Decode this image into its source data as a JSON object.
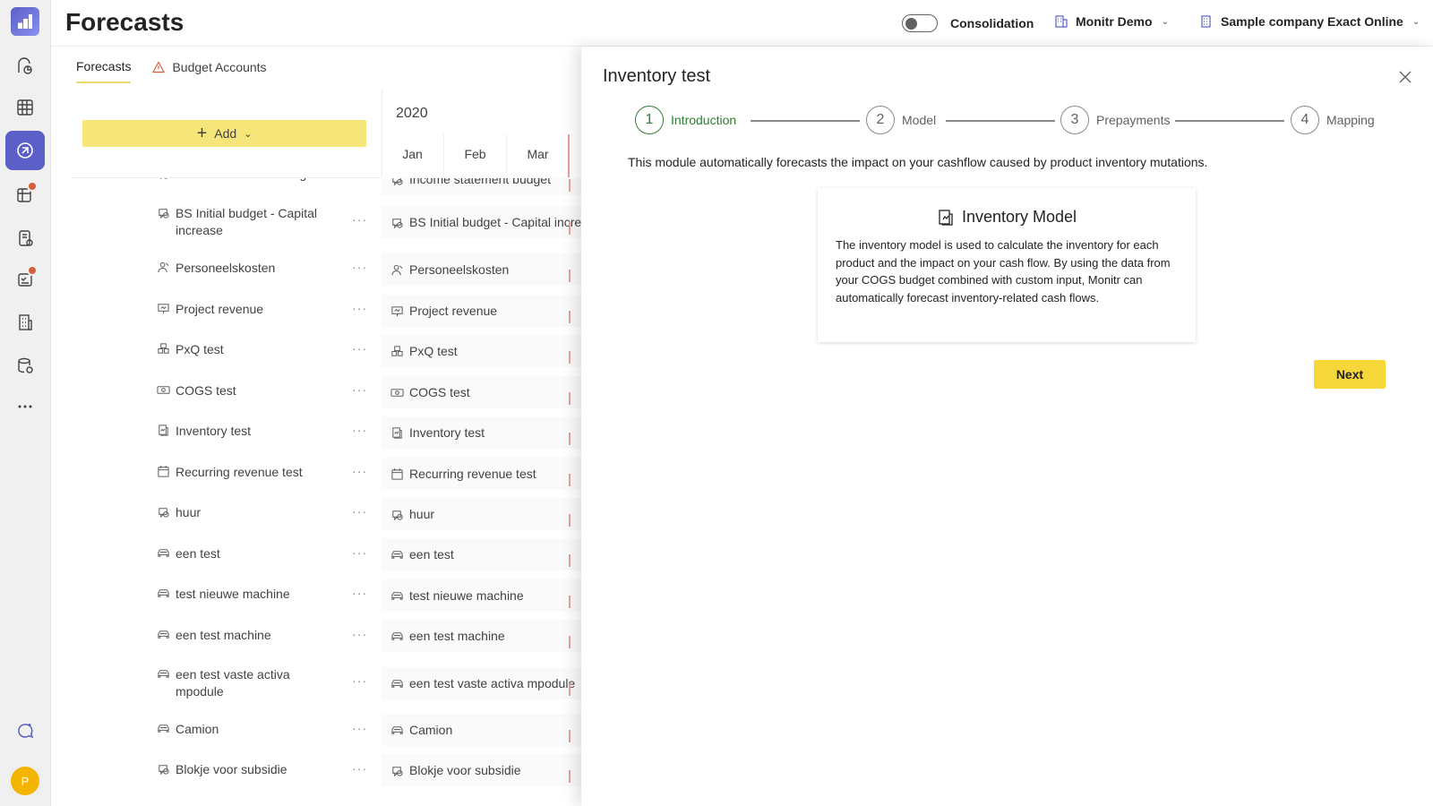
{
  "header": {
    "title": "Forecasts",
    "consolidation_label": "Consolidation",
    "environment": "Monitr Demo",
    "company": "Sample company Exact Online"
  },
  "tabs": [
    {
      "label": "Forecasts",
      "active": true
    },
    {
      "label": "Budget Accounts",
      "icon": "warning-icon"
    }
  ],
  "toolbar": {
    "add_label": "Add"
  },
  "timeline": {
    "year": "2020",
    "months": [
      "Jan",
      "Feb",
      "Mar"
    ]
  },
  "forecasts": [
    {
      "name": "Income statement budget",
      "cell": "Income statement budget",
      "icon": "budget-icon"
    },
    {
      "name": "BS Initial budget - Capital increase",
      "cell": "BS Initial budget - Capital increase",
      "icon": "budget-icon"
    },
    {
      "name": "Personeelskosten",
      "cell": "Personeelskosten",
      "icon": "person-icon"
    },
    {
      "name": "Project revenue",
      "cell": "Project revenue",
      "icon": "presentation-icon"
    },
    {
      "name": "PxQ test",
      "cell": "PxQ test",
      "icon": "boxes-icon"
    },
    {
      "name": "COGS test",
      "cell": "COGS test",
      "icon": "money-icon"
    },
    {
      "name": "Inventory test",
      "cell": "Inventory test",
      "icon": "inventory-icon"
    },
    {
      "name": "Recurring revenue test",
      "cell": "Recurring revenue test",
      "icon": "calendar-icon"
    },
    {
      "name": "huur",
      "cell": "huur",
      "icon": "budget-icon"
    },
    {
      "name": "een test",
      "cell": "een test",
      "icon": "vehicle-icon"
    },
    {
      "name": "test nieuwe machine",
      "cell": "test nieuwe machine",
      "icon": "vehicle-icon"
    },
    {
      "name": "een test machine",
      "cell": "een test machine",
      "icon": "vehicle-icon"
    },
    {
      "name": "een test vaste activa mpodule",
      "cell": "een test vaste activa mpodule",
      "icon": "vehicle-icon"
    },
    {
      "name": "Camion",
      "cell": "Camion",
      "icon": "vehicle-icon"
    },
    {
      "name": "Blokje voor subsidie",
      "cell": "Blokje voor subsidie",
      "icon": "budget-icon"
    }
  ],
  "panel": {
    "title": "Inventory test",
    "steps": [
      {
        "number": "1",
        "label": "Introduction",
        "active": true
      },
      {
        "number": "2",
        "label": "Model"
      },
      {
        "number": "3",
        "label": "Prepayments"
      },
      {
        "number": "4",
        "label": "Mapping"
      }
    ],
    "intro": "This module automatically forecasts the impact on your cashflow caused by product inventory mutations.",
    "card_title": "Inventory Model",
    "card_body": "The inventory model is used to calculate the inventory for each product and the impact on your cash flow. By using the data from your COGS budget combined with custom input, Monitr can automatically forecast inventory-related cash flows.",
    "next_label": "Next"
  },
  "user": {
    "initial": "P"
  },
  "colors": {
    "accent": "#5b5fc7",
    "active_step": "#2e7d32",
    "add_button": "#f6e67a",
    "next_button": "#f5d73a",
    "badge": "#d1603d"
  }
}
